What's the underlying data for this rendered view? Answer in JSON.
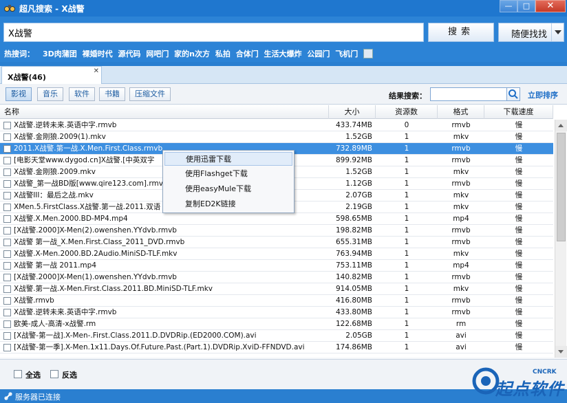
{
  "window": {
    "title": "超凡搜索 - X战警",
    "min_label": "—",
    "max_label": "□",
    "close_label": "✕"
  },
  "search": {
    "query": "X战警",
    "search_label": "搜索",
    "random_label": "随便找找"
  },
  "hot": {
    "label": "热搜词：",
    "items": [
      "3D肉蒲团",
      "裸婚时代",
      "源代码",
      "网吧门",
      "家的n次方",
      "私拍",
      "合体门",
      "生活大爆炸",
      "公园门",
      "飞机门"
    ]
  },
  "tab": {
    "label": "X战警(46)",
    "close": "✕"
  },
  "filters": {
    "categories": [
      "影视",
      "音乐",
      "软件",
      "书籍",
      "压缩文件"
    ],
    "result_search_label": "结果搜索：",
    "sort_label": "立即排序"
  },
  "table": {
    "headers": {
      "name": "名称",
      "size": "大小",
      "sources": "资源数",
      "format": "格式",
      "speed": "下载速度"
    },
    "rows": [
      {
        "name": "X战警.逆转未来.英语中字.rmvb",
        "size": "433.74MB",
        "sources": "0",
        "format": "rmvb",
        "speed": "慢"
      },
      {
        "name": "X战警.金刚狼.2009(1).mkv",
        "size": "1.52GB",
        "sources": "1",
        "format": "mkv",
        "speed": "慢"
      },
      {
        "name": "2011.X战警.第一战.X.Men.First.Class.rmvb",
        "size": "732.89MB",
        "sources": "1",
        "format": "rmvb",
        "speed": "慢"
      },
      {
        "name": "[电影天堂www.dygod.cn]X战警.[中英双字",
        "size": "899.92MB",
        "sources": "1",
        "format": "rmvb",
        "speed": "慢"
      },
      {
        "name": "X战警.金刚狼.2009.mkv",
        "size": "1.52GB",
        "sources": "1",
        "format": "mkv",
        "speed": "慢"
      },
      {
        "name": "X战警_第一战BD版[www.qire123.com].rmv",
        "size": "1.12GB",
        "sources": "1",
        "format": "rmvb",
        "speed": "慢"
      },
      {
        "name": "X战警III：最后之战.mkv",
        "size": "2.07GB",
        "sources": "1",
        "format": "mkv",
        "speed": "慢"
      },
      {
        "name": "XMen.5.FirstClass.X战警.第一战.2011.双语",
        "size": "2.19GB",
        "sources": "1",
        "format": "mkv",
        "speed": "慢"
      },
      {
        "name": "X战警.X.Men.2000.BD-MP4.mp4",
        "size": "598.65MB",
        "sources": "1",
        "format": "mp4",
        "speed": "慢"
      },
      {
        "name": "[X战警.2000]X-Men(2).owenshen.YYdvb.rmvb",
        "size": "198.82MB",
        "sources": "1",
        "format": "rmvb",
        "speed": "慢"
      },
      {
        "name": "X战警 第一战_X.Men.First.Class_2011_DVD.rmvb",
        "size": "655.31MB",
        "sources": "1",
        "format": "rmvb",
        "speed": "慢"
      },
      {
        "name": "X战警.X-Men.2000.BD.2Audio.MiniSD-TLF.mkv",
        "size": "763.94MB",
        "sources": "1",
        "format": "mkv",
        "speed": "慢"
      },
      {
        "name": "X战警 第一战 2011.mp4",
        "size": "753.11MB",
        "sources": "1",
        "format": "mp4",
        "speed": "慢"
      },
      {
        "name": "[X战警.2000]X-Men(1).owenshen.YYdvb.rmvb",
        "size": "140.82MB",
        "sources": "1",
        "format": "rmvb",
        "speed": "慢"
      },
      {
        "name": "X战警.第一战.X-Men.First.Class.2011.BD.MiniSD-TLF.mkv",
        "size": "914.05MB",
        "sources": "1",
        "format": "mkv",
        "speed": "慢"
      },
      {
        "name": "X战警.rmvb",
        "size": "416.80MB",
        "sources": "1",
        "format": "rmvb",
        "speed": "慢"
      },
      {
        "name": "X战警.逆转未来.英语中字.rmvb",
        "size": "433.80MB",
        "sources": "1",
        "format": "rmvb",
        "speed": "慢"
      },
      {
        "name": "欧美-成人-高清-x战警.rm",
        "size": "122.68MB",
        "sources": "1",
        "format": "rm",
        "speed": "慢"
      },
      {
        "name": "[X战警-第一战].X-Men-.First.Class.2011.D.DVDRip.(ED2000.COM).avi",
        "size": "2.05GB",
        "sources": "1",
        "format": "avi",
        "speed": "慢"
      },
      {
        "name": "[X战警-第一季].X-Men.1x11.Days.Of.Future.Past.(Part.1).DVDRip.XviD-FFNDVD.avi",
        "size": "174.86MB",
        "sources": "1",
        "format": "avi",
        "speed": "慢"
      }
    ],
    "selected_index": 2
  },
  "context_menu": {
    "items": [
      "使用迅雷下载",
      "使用Flashget下载",
      "使用easyMule下载",
      "复制ED2K链接"
    ],
    "hover_index": 0
  },
  "bottom": {
    "select_all": "全选",
    "invert": "反选"
  },
  "status": {
    "text": "服务器已连接"
  },
  "watermark": {
    "text": "起点软件",
    "small": "CNCRK"
  },
  "colors": {
    "accent": "#2a7fd0",
    "selected_row": "#3d8fe0",
    "link": "#1f6fc7"
  }
}
